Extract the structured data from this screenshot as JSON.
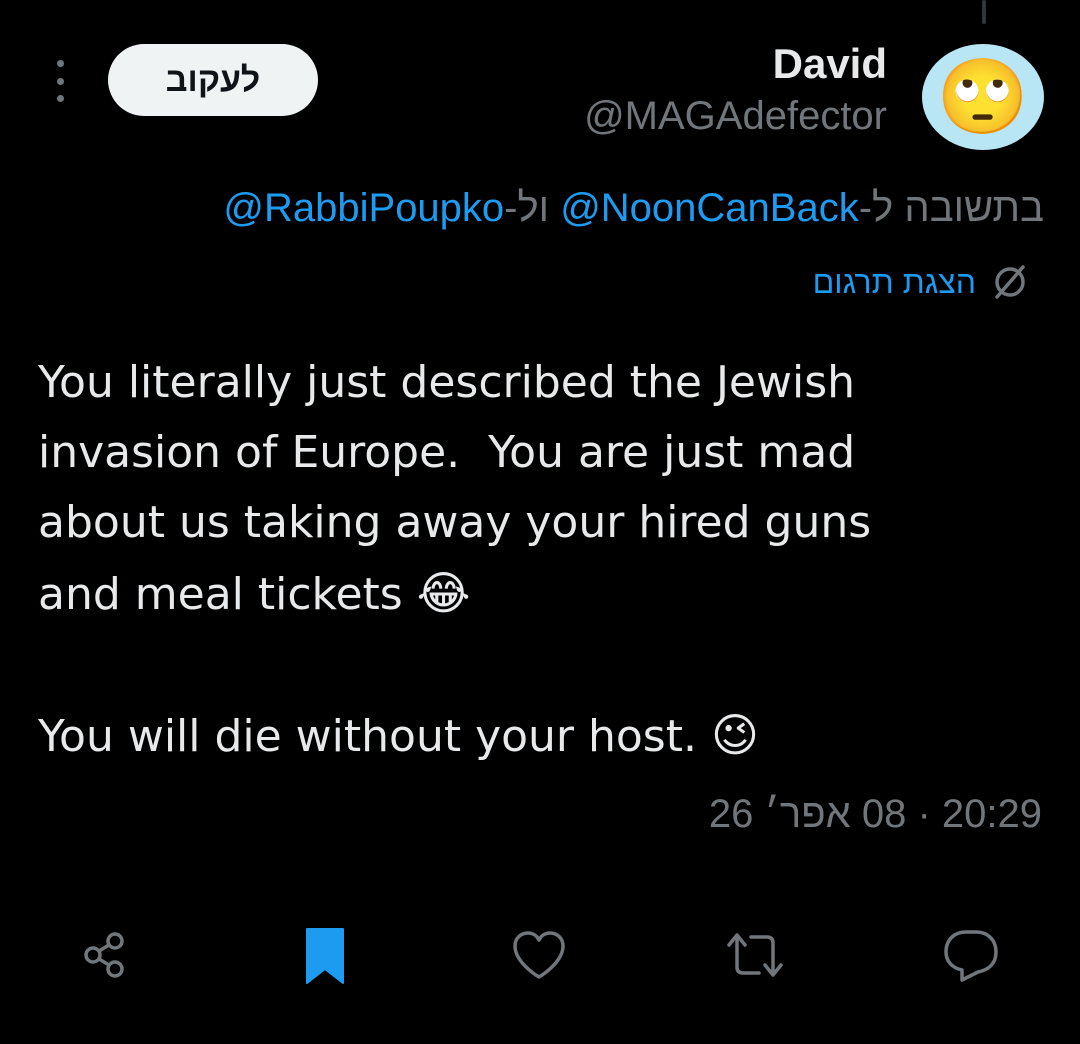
{
  "author": {
    "display_name": "David",
    "handle": "@MAGAdefector",
    "avatar_icon": "face-with-rolling-eyes"
  },
  "follow_label": "לעקוב",
  "reply_context": {
    "prefix": "בתשובה ל-",
    "mention_1": "@NoonCanBack",
    "joiner": " ול-",
    "mention_2": "@RabbiPoupko"
  },
  "translate": {
    "label": "הצגת תרגום",
    "icon": "globe-icon"
  },
  "tweet": {
    "line_1": "You literally just described the Jewish",
    "line_2": "invasion of Europe.  You are just mad",
    "line_3": "about us taking away your hired guns",
    "line_4": "and meal tickets ",
    "emoji_1": "😂",
    "line_5": "You will die without your host. ",
    "emoji_2": "😉"
  },
  "timestamp": "20:29 · 08 אפר׳ 26",
  "actions": {
    "share_icon": "share-icon",
    "bookmark_icon": "bookmark-filled-icon",
    "like_icon": "heart-icon",
    "retweet_icon": "retweet-icon",
    "reply_icon": "reply-icon"
  },
  "colors": {
    "background": "#000000",
    "text": "#e7e9ea",
    "secondary": "#71767b",
    "accent": "#1d9bf0",
    "avatar_bg": "#b9e6f5"
  }
}
